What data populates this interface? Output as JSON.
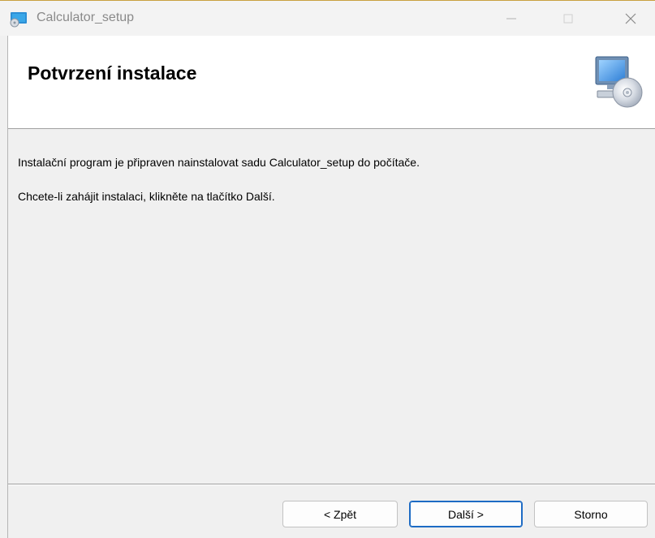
{
  "window": {
    "title": "Calculator_setup",
    "icon": "installer-app-icon",
    "controls": [
      "minimize-icon",
      "maximize-icon",
      "close-icon"
    ]
  },
  "banner": {
    "title": "Potvrzení instalace",
    "icon": "computer-with-disc-icon"
  },
  "content": {
    "line1": "Instalační program je připraven nainstalovat sadu Calculator_setup do počítače.",
    "line2": "Chcete-li zahájit instalaci, klikněte na tlačítko Další."
  },
  "buttons": {
    "back": "< Zpět",
    "next": "Další >",
    "cancel": "Storno"
  },
  "colors": {
    "default_button_border": "#1d6bc4",
    "title_text": "#8a8a8a"
  }
}
